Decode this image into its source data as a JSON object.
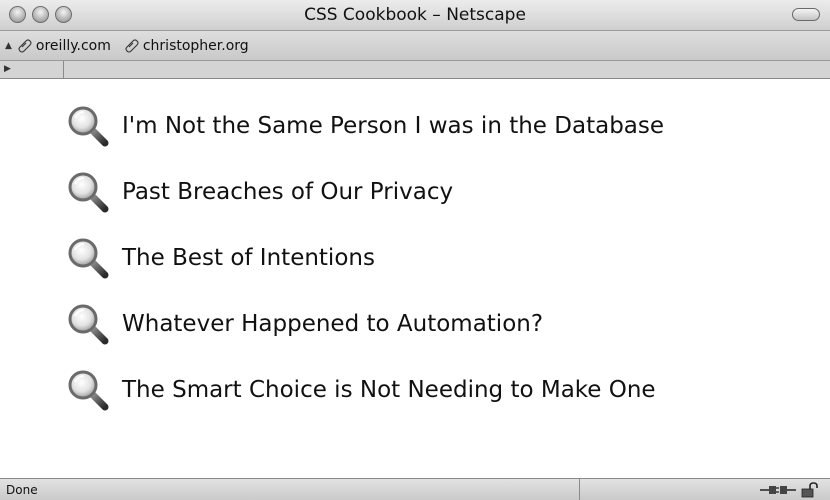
{
  "window": {
    "title": "CSS Cookbook – Netscape"
  },
  "bookmarks": [
    {
      "label": "oreilly.com",
      "icon": "bookmark-icon"
    },
    {
      "label": "christopher.org",
      "icon": "bookmark-icon"
    }
  ],
  "items": [
    {
      "label": "I'm Not the Same Person I was in the Database",
      "icon": "magnifier-icon"
    },
    {
      "label": "Past Breaches of Our Privacy",
      "icon": "magnifier-icon"
    },
    {
      "label": "The Best of Intentions",
      "icon": "magnifier-icon"
    },
    {
      "label": "Whatever Happened to Automation?",
      "icon": "magnifier-icon"
    },
    {
      "label": "The Smart Choice is Not Needing to Make One",
      "icon": "magnifier-icon"
    }
  ],
  "status": {
    "text": "Done"
  }
}
